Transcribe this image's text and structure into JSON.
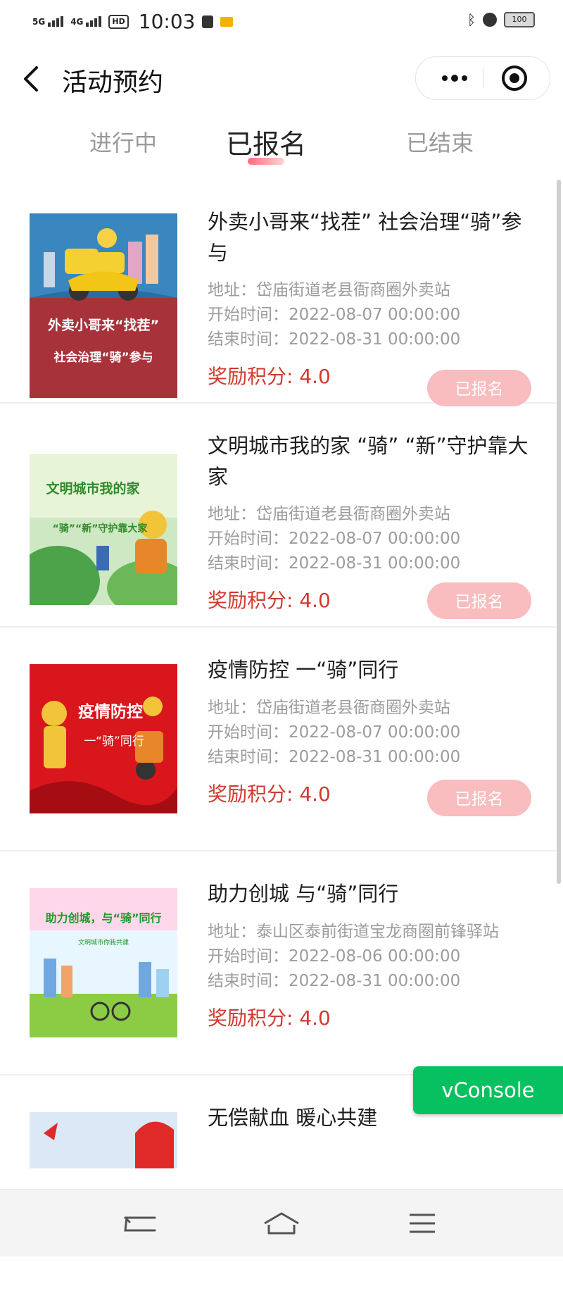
{
  "status_bar": {
    "network1": "5G",
    "network2": "4G",
    "hd": "HD",
    "time": "10:03",
    "battery": "100"
  },
  "header": {
    "title": "活动预约"
  },
  "tabs": [
    {
      "label": "进行中",
      "active": false
    },
    {
      "label": "已报名",
      "active": true
    },
    {
      "label": "已结束",
      "active": false
    }
  ],
  "activities": [
    {
      "title": "外卖小哥来“找茬” 社会治理“骑”参与",
      "address": "地址：岱庙街道老县衙商圈外卖站",
      "start": "开始时间：2022-08-07 00:00:00",
      "end": "结束时间：2022-08-31 00:00:00",
      "reward": "奖励积分: 4.0",
      "button": "已报名",
      "poster_text": [
        "外卖小哥来“找茬”",
        "社会治理“骑”参与"
      ]
    },
    {
      "title": "文明城市我的家 “骑” “新”守护靠大家",
      "address": "地址：岱庙街道老县衙商圈外卖站",
      "start": "开始时间：2022-08-07 00:00:00",
      "end": "结束时间：2022-08-31 00:00:00",
      "reward": "奖励积分: 4.0",
      "button": "已报名",
      "poster_text": [
        "文明城市我的家",
        "“骑”“新”守护靠大家"
      ]
    },
    {
      "title": "疫情防控 一“骑”同行",
      "address": "地址：岱庙街道老县衙商圈外卖站",
      "start": "开始时间：2022-08-07 00:00:00",
      "end": "结束时间：2022-08-31 00:00:00",
      "reward": "奖励积分: 4.0",
      "button": "已报名",
      "poster_text": [
        "疫情防控",
        "一“骑”同行"
      ]
    },
    {
      "title": "助力创城 与“骑”同行",
      "address": "地址：泰山区泰前街道宝龙商圈前锋驿站",
      "start": "开始时间：2022-08-06 00:00:00",
      "end": "结束时间：2022-08-31 00:00:00",
      "reward": "奖励积分: 4.0",
      "poster_text": [
        "助力创城，与“骑”同行",
        "文明城市你我共建"
      ]
    },
    {
      "title": "无偿献血 暖心共建"
    }
  ],
  "vconsole": {
    "label": "vConsole"
  },
  "icons": {
    "back": "chevron-left-icon",
    "more": "more-dots-icon",
    "close": "target-circle-icon",
    "nav_back": "back-arrow-icon",
    "nav_home": "home-icon",
    "nav_menu": "menu-icon"
  },
  "colors": {
    "reward": "#d23a30",
    "signed_button": "#f9bcbf",
    "vconsole": "#07c160",
    "tab_underline": "#ff6b7a"
  }
}
